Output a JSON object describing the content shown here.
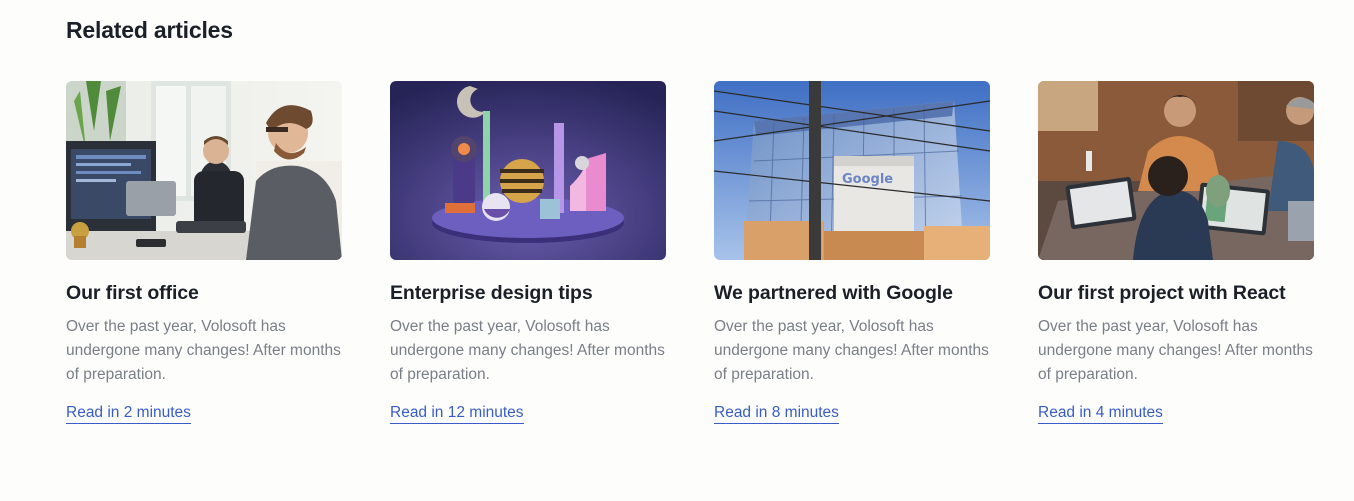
{
  "section": {
    "title": "Related articles"
  },
  "colors": {
    "link": "#3a5cc9",
    "title": "#1b1f27",
    "body_text": "#7a7e86",
    "background": "#fdfdfb"
  },
  "articles": [
    {
      "title": "Our first office",
      "description": "Over the past year, Volosoft has undergone many changes! After months of preparation.",
      "link": "Read in 2 minutes",
      "image": "photo-office-developers"
    },
    {
      "title": "Enterprise design tips",
      "description": "Over the past year, Volosoft has undergone many changes! After months of preparation.",
      "link": "Read in 12 minutes",
      "image": "illustration-3d-shapes"
    },
    {
      "title": "We partnered with Google",
      "description": "Over the past year, Volosoft has undergone many changes! After months of preparation.",
      "link": "Read in 8 minutes",
      "image": "photo-google-building"
    },
    {
      "title": "Our first project with React",
      "description": "Over the past year, Volosoft has undergone many changes! After months of preparation.",
      "link": "Read in 4 minutes",
      "image": "photo-team-laptops"
    }
  ]
}
